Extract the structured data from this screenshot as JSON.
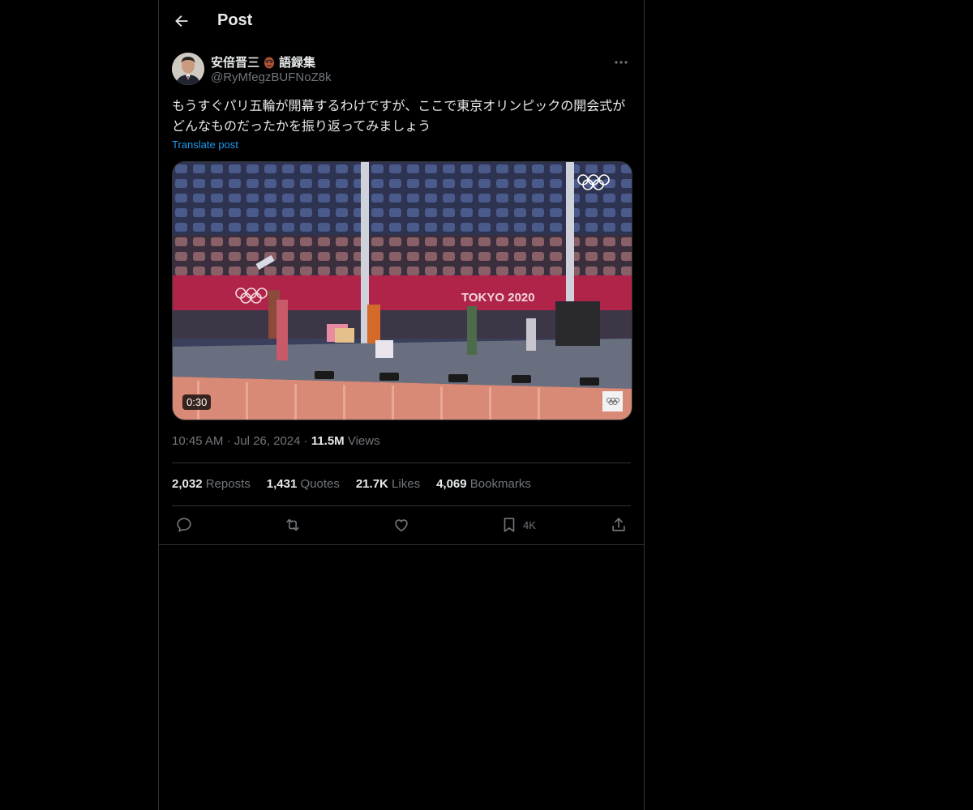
{
  "header": {
    "title": "Post"
  },
  "author": {
    "display_name": "安倍晋三",
    "suffix": "語録集",
    "handle": "@RyMfegzBUFNoZ8k"
  },
  "tweet": {
    "text": "もうすぐパリ五輪が開幕するわけですが、ここで東京オリンピックの開会式がどんなものだったかを振り返ってみましょう",
    "translate_label": "Translate post"
  },
  "media": {
    "duration": "0:30",
    "banner_text": "TOKYO 2020"
  },
  "meta": {
    "time": "10:45 AM",
    "date": "Jul 26, 2024",
    "views_count": "11.5M",
    "views_label": "Views"
  },
  "stats": {
    "reposts_count": "2,032",
    "reposts_label": "Reposts",
    "quotes_count": "1,431",
    "quotes_label": "Quotes",
    "likes_count": "21.7K",
    "likes_label": "Likes",
    "bookmarks_count": "4,069",
    "bookmarks_label": "Bookmarks"
  },
  "actions": {
    "bookmark_count": "4K"
  },
  "icons": [
    "back-arrow-icon",
    "more-icon",
    "reply-icon",
    "repost-icon",
    "like-icon",
    "bookmark-icon",
    "share-icon",
    "mask-emoji-icon"
  ],
  "colors": {
    "accent": "#1d9bf0",
    "background": "#000000",
    "text": "#e7e9ea",
    "secondary": "#71767b",
    "border": "#2f3336"
  }
}
